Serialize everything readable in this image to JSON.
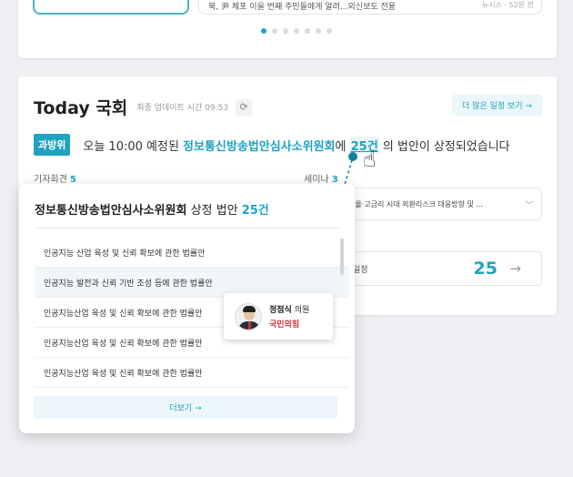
{
  "top": {
    "news_text": "북, 尹 체포 이을 번째 주민들에게 알려...외신보도 전용",
    "news_source": "뉴시스 · 52분 전",
    "dots_count": 7,
    "active_dot": 0
  },
  "header": {
    "title": "Today 국회",
    "updated": "최종 업데이트 시간 09:53",
    "refresh_icon": "refresh-icon",
    "more_schedule": "더 많은 일정 보기 →"
  },
  "notice": {
    "badge": "과방위",
    "prefix": "오늘 10:00 예정된",
    "committee": "정보통신방송법안심사소위원회",
    "particle": "에",
    "count": "25건",
    "suffix": "의 법안이 상정되었습니다"
  },
  "columns": {
    "press_label": "기자회견",
    "press_count": "5",
    "seminar_label": "세미나",
    "seminar_count": "3",
    "seminar_item": "0   고환율·고금리 시대 외환리스크 대응방향 및 ...",
    "schedule_label": "일정",
    "schedule_count": "25",
    "schedule_arrow": "→"
  },
  "popup": {
    "title_name": "정보통신방송법안심사소위원회",
    "title_mid": " 상정 법안 ",
    "title_count": "25건",
    "bills": [
      "인공지능 산업 육성 및 신뢰 확보에 관한 법률안",
      "인공지능 발전과 신뢰 기반 조성 등에 관한 법률안",
      "인공지능산업 육성 및 신뢰 확보에 관한 법률안",
      "인공지능산업 육성 및 신뢰 확보에 관한 법률안",
      "인공지능산업 육성 및 신뢰 확보에 관한 법률안"
    ],
    "more": "더보기 →"
  },
  "tooltip": {
    "name": "정점식",
    "role": "의원",
    "party": "국민의힘"
  },
  "colors": {
    "accent": "#1ea3c0",
    "party": "#d1303a"
  }
}
